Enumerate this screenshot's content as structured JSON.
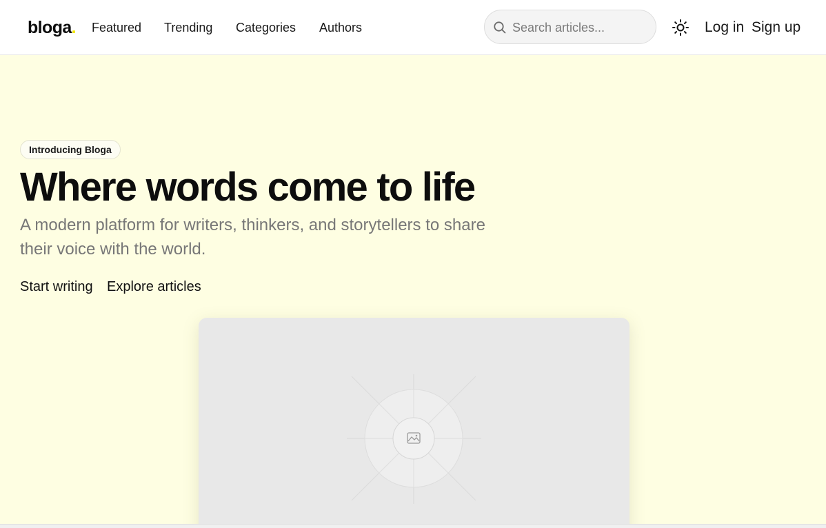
{
  "brand": {
    "name": "bloga",
    "dot": ".",
    "dot_color": "#f2e600"
  },
  "nav": {
    "items": [
      {
        "label": "Featured"
      },
      {
        "label": "Trending"
      },
      {
        "label": "Categories"
      },
      {
        "label": "Authors"
      }
    ]
  },
  "search": {
    "placeholder": "Search articles...",
    "value": "",
    "icon": "search-icon"
  },
  "theme_toggle": {
    "icon": "sun-icon"
  },
  "auth": {
    "login_label": "Log in",
    "signup_label": "Sign up"
  },
  "hero": {
    "badge": "Introducing Bloga",
    "title": "Where words come to life",
    "subtitle": "A modern platform for writers, thinkers, and storytellers to share their voice with the world.",
    "primary_cta": "Start writing",
    "secondary_cta": "Explore articles",
    "background": "#fefee2",
    "preview_icon": "image-placeholder-icon"
  }
}
